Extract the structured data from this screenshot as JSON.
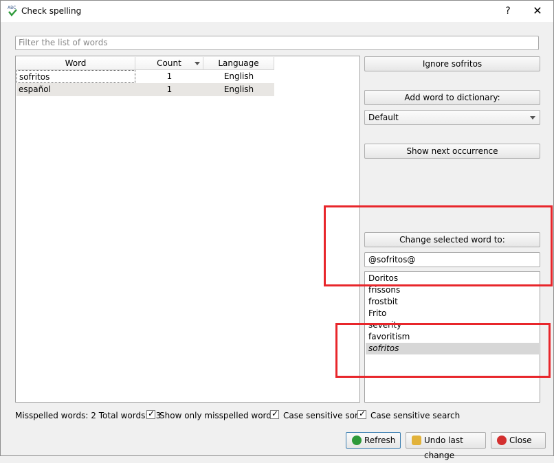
{
  "window": {
    "title": "Check spelling",
    "help": "?",
    "close": "✕"
  },
  "filter": {
    "placeholder": "Filter the list of words"
  },
  "table": {
    "columns": [
      "Word",
      "Count",
      "Language"
    ],
    "rows": [
      {
        "word": "sofritos",
        "count": "1",
        "language": "English"
      },
      {
        "word": "español",
        "count": "1",
        "language": "English"
      }
    ]
  },
  "actions": {
    "ignore_label": "Ignore sofritos",
    "add_label": "Add word to dictionary:",
    "dictionary_selected": "Default",
    "next_label": "Show next occurrence",
    "change_label": "Change selected word to:",
    "change_value": "@sofritos@",
    "suggestions": [
      "Doritos",
      "frissons",
      "frostbit",
      "Frito",
      "severity",
      "favoritism",
      "sofritos"
    ]
  },
  "status": {
    "summary": "Misspelled words: 2 Total words: 13",
    "show_only": "Show only misspelled words",
    "case_sort": "Case sensitive sort",
    "case_search": "Case sensitive search"
  },
  "buttons": {
    "refresh": "Refresh",
    "undo": "Undo last change",
    "close": "Close"
  },
  "colors": {
    "annotation": "#e8262b",
    "selection": "#d7d7d7",
    "alt_row": "#e8e6e3"
  }
}
